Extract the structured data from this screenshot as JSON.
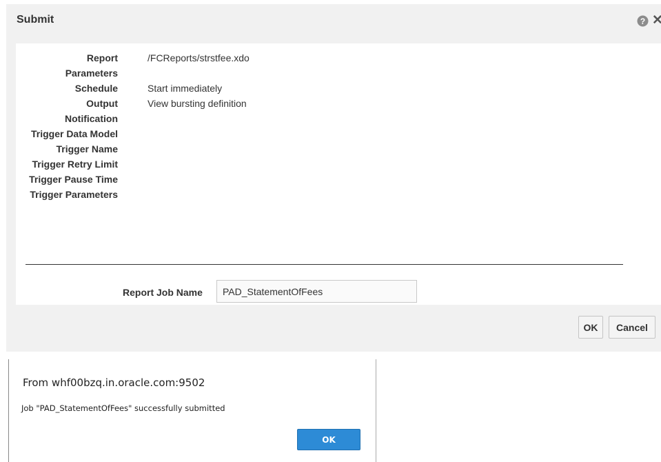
{
  "submit_dialog": {
    "title": "Submit",
    "fields": [
      {
        "label": "Report",
        "value": "/FCReports/strstfee.xdo"
      },
      {
        "label": "Parameters",
        "value": ""
      },
      {
        "label": "Schedule",
        "value": "Start immediately"
      },
      {
        "label": "Output",
        "value": "View bursting definition"
      },
      {
        "label": "Notification",
        "value": ""
      },
      {
        "label": "Trigger Data Model",
        "value": ""
      },
      {
        "label": "Trigger Name",
        "value": ""
      },
      {
        "label": "Trigger Retry Limit",
        "value": ""
      },
      {
        "label": "Trigger Pause Time",
        "value": ""
      },
      {
        "label": "Trigger Parameters",
        "value": ""
      }
    ],
    "job_name_label": "Report Job Name",
    "job_name_value": "PAD_StatementOfFees",
    "ok_label": "OK",
    "cancel_label": "Cancel",
    "icons": {
      "help": "help-icon",
      "close": "close-icon"
    },
    "close_glyph": "✕",
    "help_glyph": "?"
  },
  "alert": {
    "title": "From whf00bzq.in.oracle.com:9502",
    "message": "Job \"PAD_StatementOfFees\" successfully submitted",
    "ok_label": "OK",
    "ok_color": "#2d8bd6"
  }
}
